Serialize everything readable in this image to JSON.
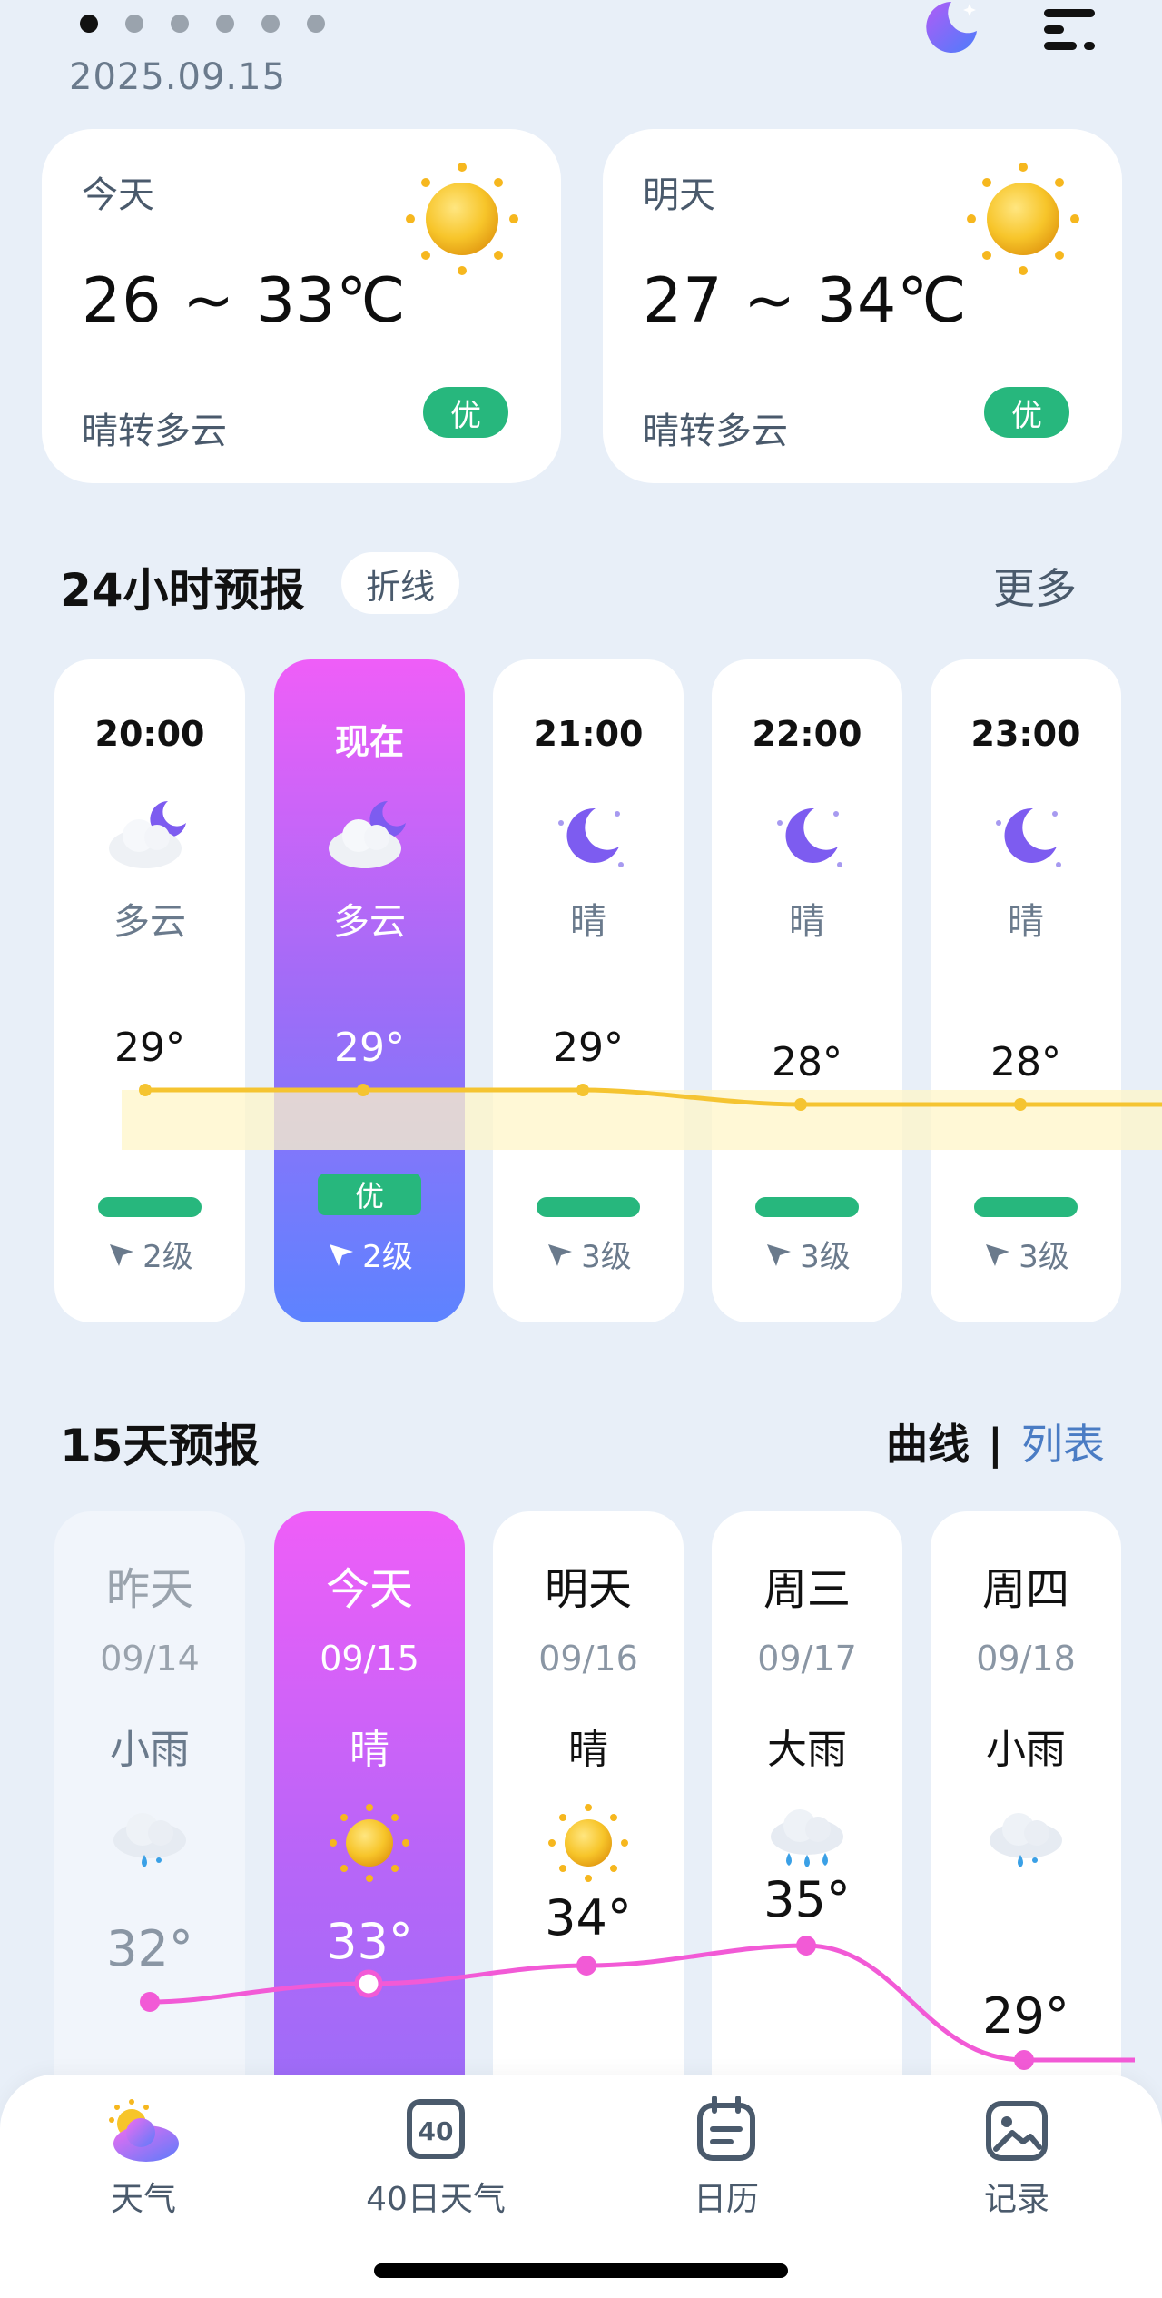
{
  "header": {
    "date": "2025.09.15",
    "page_dots": 6,
    "active_dot": 0
  },
  "day_cards": [
    {
      "label": "今天",
      "temp_range": "26 ~ 33℃",
      "condition": "晴转多云",
      "aqi": "优",
      "icon": "sun-icon"
    },
    {
      "label": "明天",
      "temp_range": "27 ~ 34℃",
      "condition": "晴转多云",
      "aqi": "优",
      "icon": "sun-icon"
    }
  ],
  "hourly": {
    "title": "24小时预报",
    "mode_label": "折线",
    "more_label": "更多",
    "items": [
      {
        "time": "20:00",
        "condition": "多云",
        "temp": "29°",
        "wind": "2级",
        "icon": "cloudy-night-icon"
      },
      {
        "time": "现在",
        "condition": "多云",
        "temp": "29°",
        "wind": "2级",
        "aqi": "优",
        "icon": "cloudy-night-icon"
      },
      {
        "time": "21:00",
        "condition": "晴",
        "temp": "29°",
        "wind": "3级",
        "icon": "moon-icon"
      },
      {
        "time": "22:00",
        "condition": "晴",
        "temp": "28°",
        "wind": "3级",
        "icon": "moon-icon"
      },
      {
        "time": "23:00",
        "condition": "晴",
        "temp": "28°",
        "wind": "3级",
        "icon": "moon-icon"
      }
    ]
  },
  "daily": {
    "title": "15天预报",
    "view_curve": "曲线",
    "view_list": "列表",
    "items": [
      {
        "weekday": "昨天",
        "date": "09/14",
        "condition": "小雨",
        "high": "32°",
        "icon": "light-rain-icon"
      },
      {
        "weekday": "今天",
        "date": "09/15",
        "condition": "晴",
        "high": "33°",
        "icon": "sun-icon"
      },
      {
        "weekday": "明天",
        "date": "09/16",
        "condition": "晴",
        "high": "34°",
        "icon": "sun-icon"
      },
      {
        "weekday": "周三",
        "date": "09/17",
        "condition": "大雨",
        "high": "35°",
        "icon": "heavy-rain-icon"
      },
      {
        "weekday": "周四",
        "date": "09/18",
        "condition": "小雨",
        "high": "29°",
        "icon": "light-rain-icon"
      }
    ]
  },
  "nav": {
    "items": [
      {
        "label": "天气",
        "icon": "weather-icon"
      },
      {
        "label": "40日天气",
        "icon": "forty-day-icon",
        "badge": "40"
      },
      {
        "label": "日历",
        "icon": "calendar-icon"
      },
      {
        "label": "记录",
        "icon": "photo-record-icon"
      }
    ]
  },
  "colors": {
    "background": "#e8eff8",
    "aqi_good": "#27b77d",
    "hourly_line": "#f5c431",
    "daily_line": "#f25ad6",
    "accent_gradient_top": "#ef5ef8",
    "accent_gradient_bottom": "#5d83ff"
  }
}
